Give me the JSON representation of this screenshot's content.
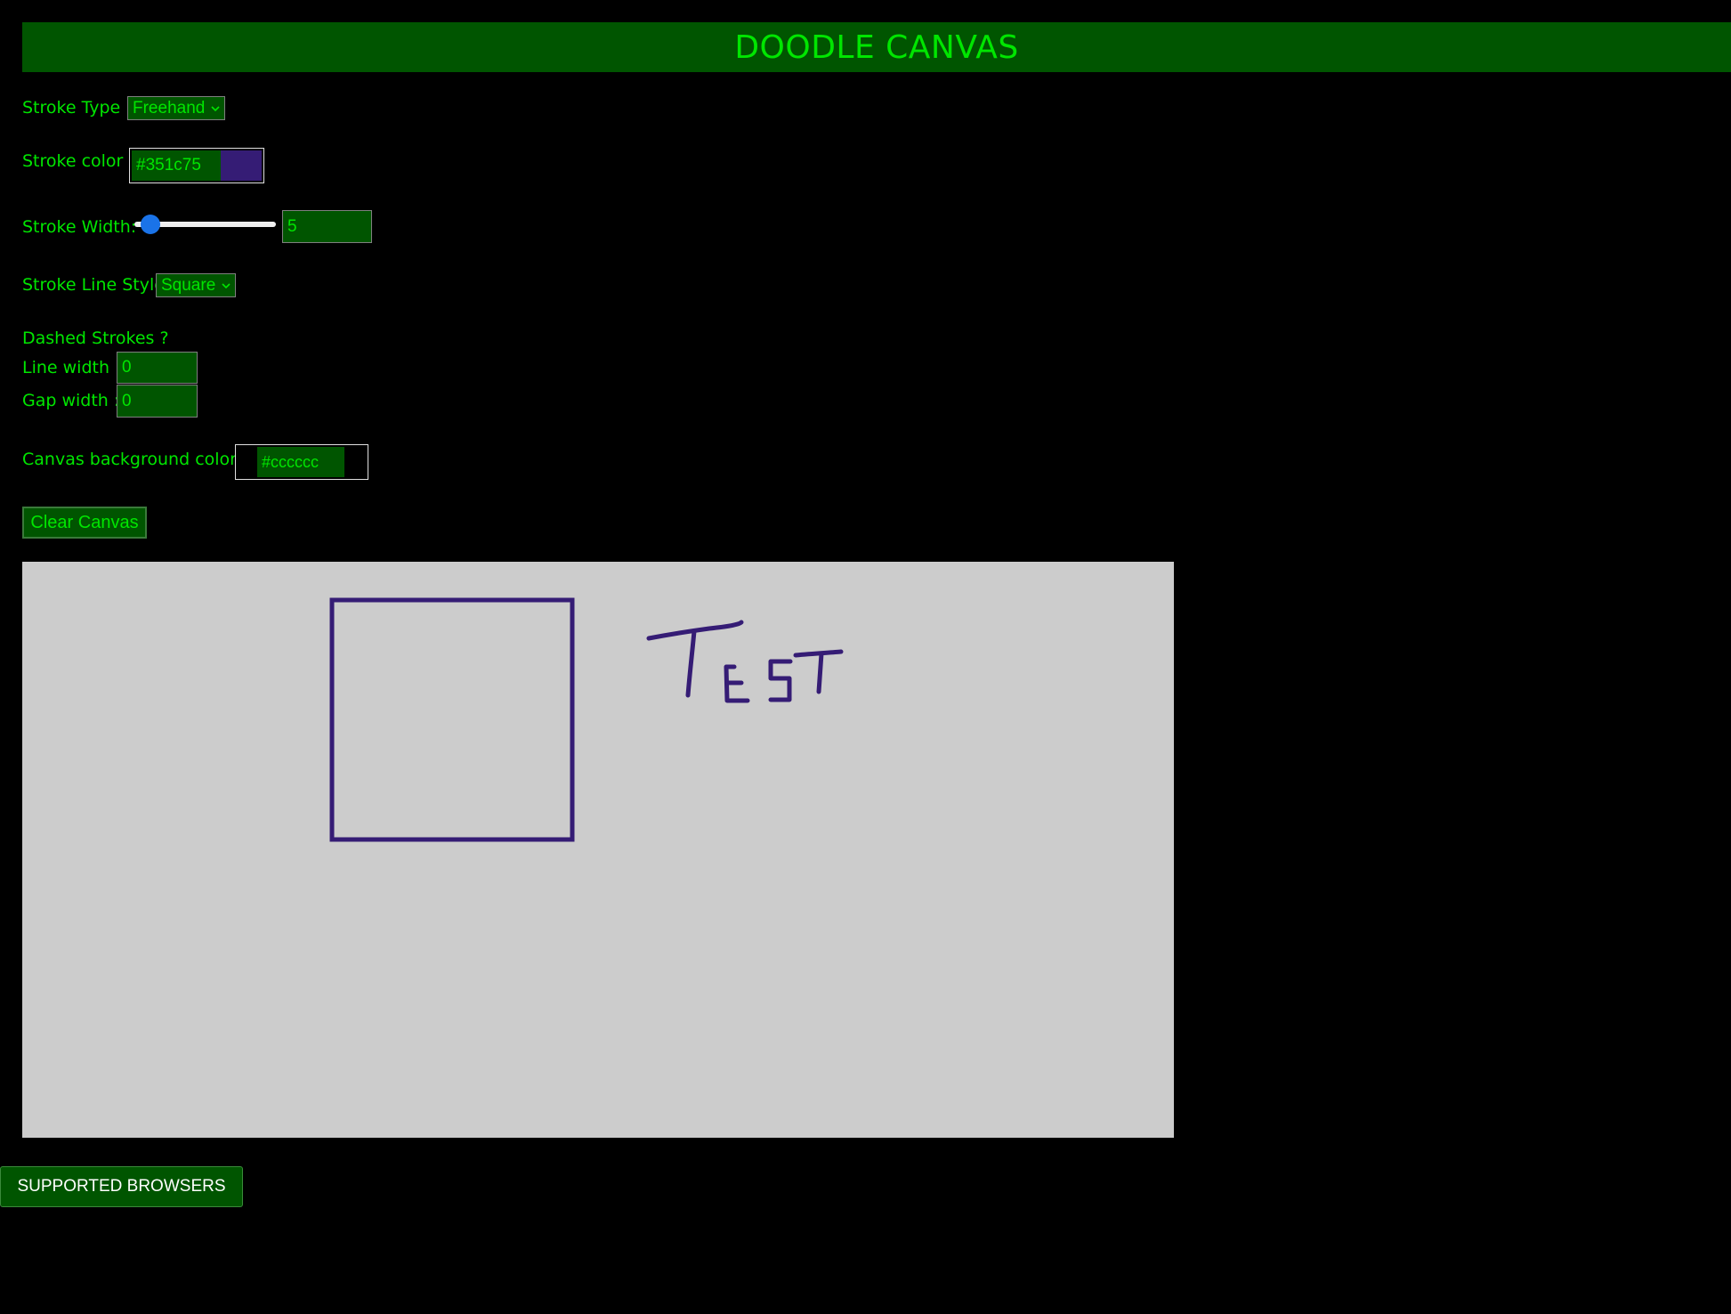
{
  "header": {
    "title": "DOODLE CANVAS"
  },
  "stroke_type": {
    "label": "Stroke Type :",
    "selected": "Freehand"
  },
  "stroke_color": {
    "label": "Stroke color :",
    "value": "#351c75",
    "swatch": "#351c75"
  },
  "stroke_width": {
    "label": "Stroke Width:",
    "value": "5",
    "slider_level": 0.05
  },
  "stroke_line_style": {
    "label": "Stroke Line Style",
    "selected": "Square"
  },
  "dashed": {
    "heading": "Dashed Strokes ?",
    "line_width_label": "Line width :",
    "line_width_value": "0",
    "gap_width_label": "Gap width :",
    "gap_width_value": "0"
  },
  "canvas_bg": {
    "label": "Canvas background color :",
    "value": "#cccccc",
    "color": "#cccccc"
  },
  "clear_button": {
    "label": "Clear Canvas"
  },
  "canvas": {
    "drawn_text": "TEST"
  },
  "supported_browsers_button": {
    "label": "SUPPORTED BROWSERS"
  },
  "colors": {
    "accent_green": "#00e600",
    "header_bg": "#005500",
    "page_bg": "#000000",
    "stroke": "#351c75",
    "slider_thumb": "#1a73e8"
  }
}
